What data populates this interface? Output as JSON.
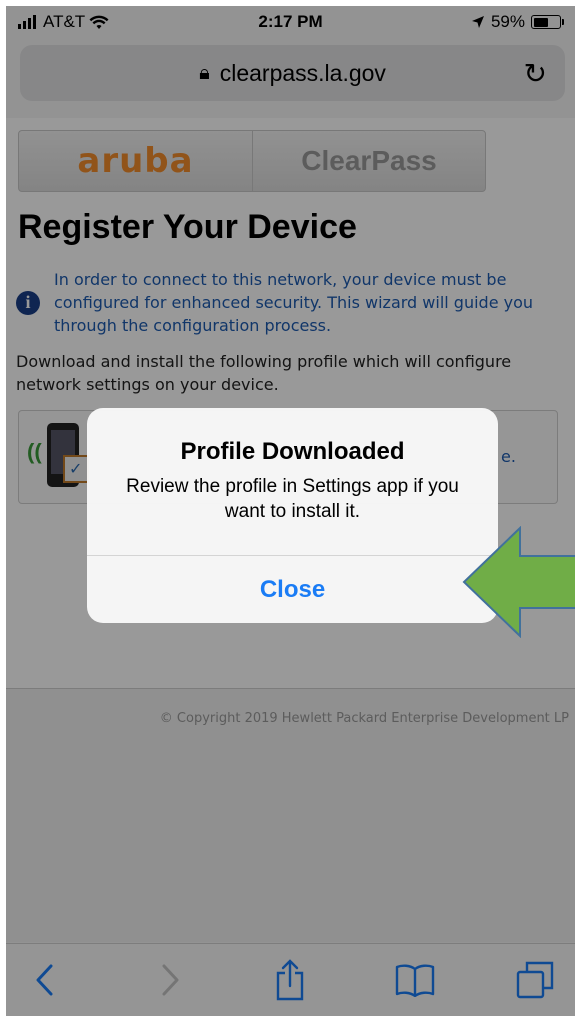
{
  "status_bar": {
    "carrier": "AT&T",
    "time": "2:17 PM",
    "battery": "59%",
    "battery_level": 0.59
  },
  "url_bar": {
    "url": "clearpass.la.gov"
  },
  "page": {
    "brand_left": "aruba",
    "brand_right": "ClearPass",
    "heading": "Register Your Device",
    "info_text": "In order to connect to this network, your device must be configured for enhanced security. This wizard will guide you through the configuration process.",
    "description": "Download and install the following profile which will configure network settings on your device.",
    "link_tail": "e.",
    "copyright": "© Copyright 2019 Hewlett Packard Enterprise Development LP"
  },
  "alert": {
    "title": "Profile Downloaded",
    "message": "Review the profile in Settings app if you want to install it.",
    "close_label": "Close"
  },
  "toolbar": {
    "icons": [
      "back-icon",
      "forward-icon",
      "share-icon",
      "bookmarks-icon",
      "tabs-icon"
    ]
  },
  "colors": {
    "ios_blue": "#1a7cf5",
    "aruba_orange": "#f28d2c",
    "arrow_green": "#70ad47",
    "arrow_border": "#41719c"
  }
}
